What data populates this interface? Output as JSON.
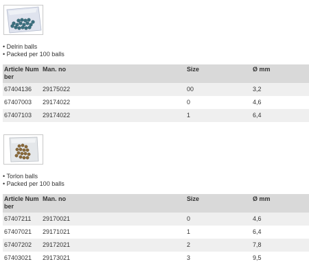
{
  "products": [
    {
      "image_icon": "blue-balls-in-bag-icon",
      "bullets": [
        "• Delrin balls",
        "• Packed per 100 balls"
      ],
      "headers": [
        "Article Number",
        "Man. no",
        "Size",
        "Ø mm"
      ],
      "rows": [
        [
          "67404136",
          "29175022",
          "00",
          "3,2"
        ],
        [
          "67407003",
          "29174022",
          "0",
          "4,6"
        ],
        [
          "67407103",
          "29174022",
          "1",
          "6,4"
        ]
      ]
    },
    {
      "image_icon": "brown-balls-in-bag-icon",
      "bullets": [
        "• Torlon balls",
        "• Packed per 100 balls"
      ],
      "headers": [
        "Article Number",
        "Man. no",
        "Size",
        "Ø mm"
      ],
      "rows": [
        [
          "67407211",
          "29170021",
          "0",
          "4,6"
        ],
        [
          "67407021",
          "29171021",
          "1",
          "6,4"
        ],
        [
          "67407202",
          "29172021",
          "2",
          "7,8"
        ],
        [
          "67403021",
          "29173021",
          "3",
          "9,5"
        ]
      ]
    }
  ]
}
